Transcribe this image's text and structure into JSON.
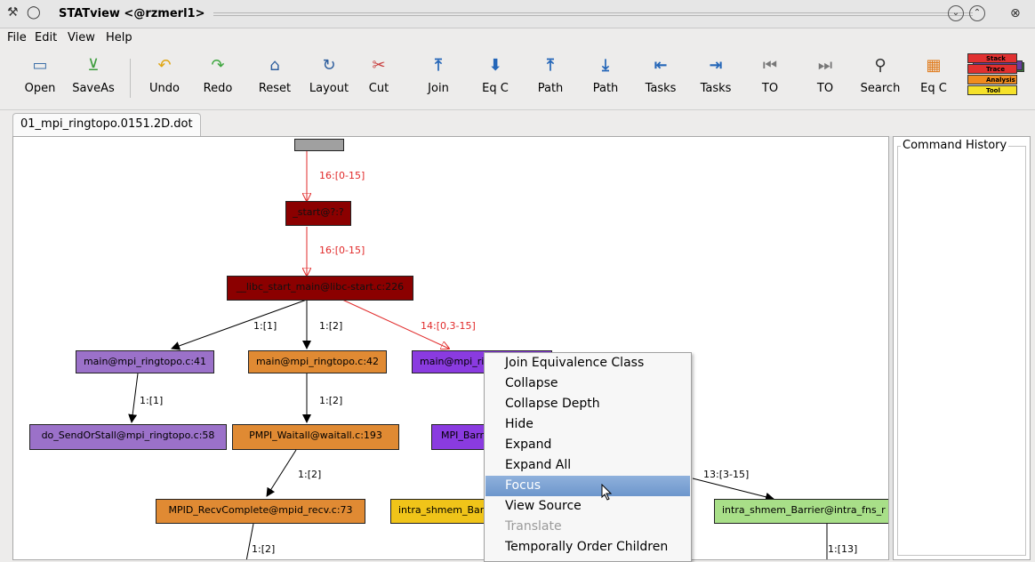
{
  "window": {
    "title": "STATview <@rzmerl1>"
  },
  "menubar": [
    "File",
    "Edit",
    "View",
    "Help"
  ],
  "toolbar": {
    "buttons": [
      "Open",
      "SaveAs",
      "Undo",
      "Redo",
      "Reset",
      "Layout",
      "Cut",
      "Join",
      "Eq C",
      "Path",
      "Path",
      "Tasks",
      "Tasks",
      "TO",
      "TO",
      "Search",
      "Eq C"
    ],
    "logo_lines": [
      "Stack",
      "Trace",
      "Analysis",
      "Tool"
    ]
  },
  "tab": {
    "label": "01_mpi_ringtopo.0151.2D.dot"
  },
  "graph": {
    "nodes": [
      {
        "label": "",
        "color": "#a0a0a0"
      },
      {
        "label": "_start@?:?",
        "color": "#8b0000"
      },
      {
        "label": "__libc_start_main@libc-start.c:226",
        "color": "#8b0000"
      },
      {
        "label": "main@mpi_ringtopo.c:41",
        "color": "#9b71c9"
      },
      {
        "label": "main@mpi_ringtopo.c:42",
        "color": "#e08a33"
      },
      {
        "label": "main@mpi_ri",
        "color": "#8a3be0"
      },
      {
        "label": "do_SendOrStall@mpi_ringtopo.c:58",
        "color": "#9b71c9"
      },
      {
        "label": "PMPI_Waitall@waitall.c:193",
        "color": "#e08a33"
      },
      {
        "label": "MPI_Barr",
        "color": "#8a3be0"
      },
      {
        "label": "MPID_RecvComplete@mpid_recv.c:73",
        "color": "#e08a33"
      },
      {
        "label": "intra_shmem_Bar",
        "color": "#f0c419"
      },
      {
        "label": "intra_shmem_Barrier@intra_fns_r",
        "color": "#a8df88"
      }
    ],
    "edges": [
      {
        "label": "16:[0-15]",
        "color": "#e12a2a"
      },
      {
        "label": "16:[0-15]",
        "color": "#e12a2a"
      },
      {
        "label": "1:[1]",
        "color": "#000000"
      },
      {
        "label": "1:[2]",
        "color": "#000000"
      },
      {
        "label": "14:[0,3-15]",
        "color": "#e12a2a"
      },
      {
        "label": "1:[1]",
        "color": "#000000"
      },
      {
        "label": "1:[2]",
        "color": "#000000"
      },
      {
        "label": "1:[2]",
        "color": "#000000"
      },
      {
        "label": "13:[3-15]",
        "color": "#000000"
      },
      {
        "label": "1:[2]",
        "color": "#000000"
      },
      {
        "label": "1:[13]",
        "color": "#000000"
      }
    ]
  },
  "command_history": {
    "title": "Command History"
  },
  "context_menu": {
    "items": [
      {
        "label": "Join Equivalence Class",
        "state": "normal"
      },
      {
        "label": "Collapse",
        "state": "normal"
      },
      {
        "label": "Collapse Depth",
        "state": "normal"
      },
      {
        "label": "Hide",
        "state": "normal"
      },
      {
        "label": "Expand",
        "state": "normal"
      },
      {
        "label": "Expand All",
        "state": "normal"
      },
      {
        "label": "Focus",
        "state": "highlighted"
      },
      {
        "label": "View Source",
        "state": "normal"
      },
      {
        "label": "Translate",
        "state": "disabled"
      },
      {
        "label": "Temporally Order Children",
        "state": "normal"
      }
    ]
  }
}
